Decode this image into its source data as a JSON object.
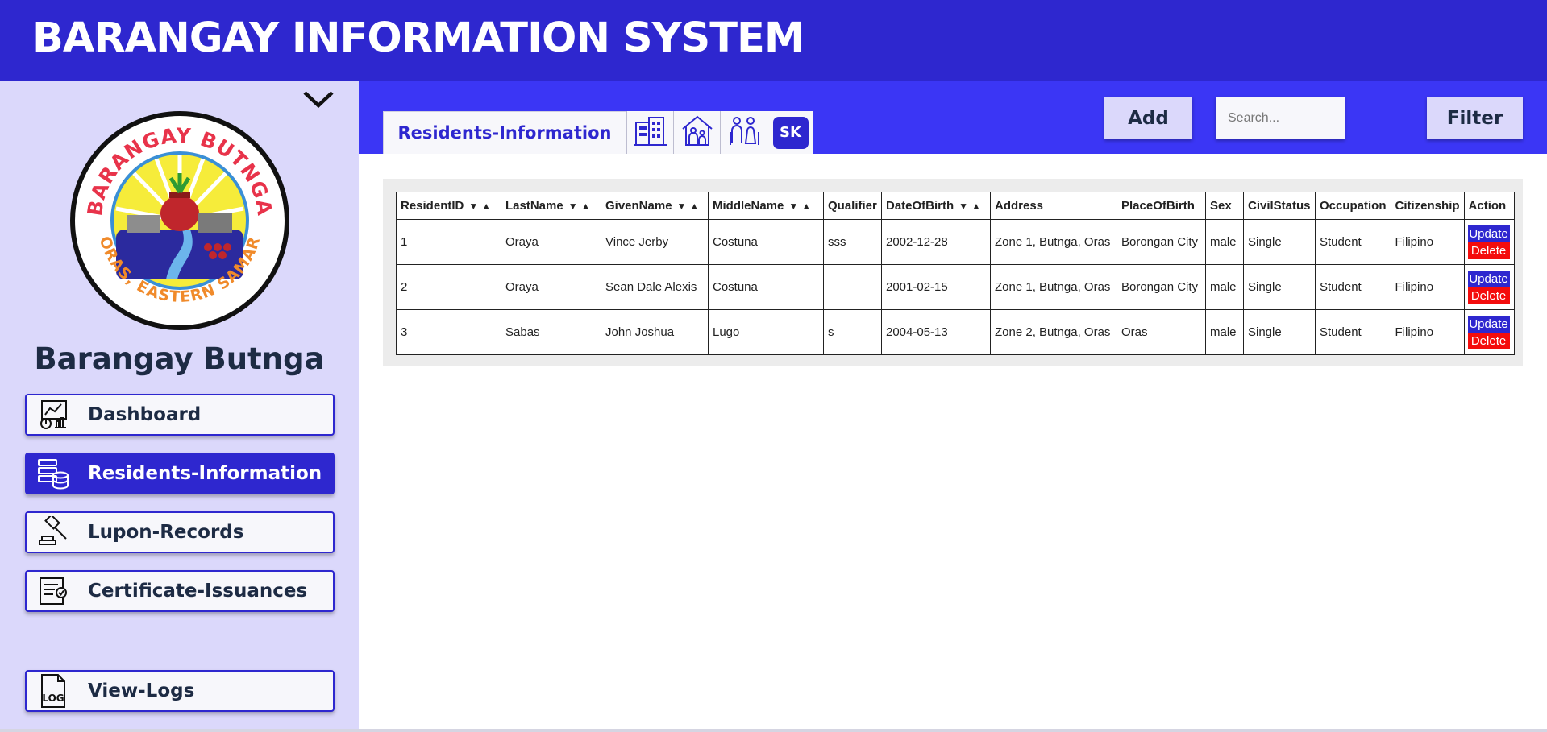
{
  "app": {
    "title": "BARANGAY INFORMATION SYSTEM"
  },
  "sidebar": {
    "barangay_name": "Barangay Butnga",
    "logo_text": {
      "top": "BARANGAY BUTNGA",
      "bottom": "ORAS, EASTERN SAMAR"
    },
    "items": [
      {
        "label": "Dashboard",
        "icon": "dashboard-chart-icon",
        "active": false
      },
      {
        "label": "Residents-Information",
        "icon": "database-icon",
        "active": true
      },
      {
        "label": "Lupon-Records",
        "icon": "gavel-icon",
        "active": false
      },
      {
        "label": "Certificate-Issuances",
        "icon": "certificate-icon",
        "active": false
      },
      {
        "label": "View-Logs",
        "icon": "log-file-icon",
        "active": false
      }
    ]
  },
  "main": {
    "tabs": {
      "active_label": "Residents-Information",
      "icon_tabs": [
        "buildings-icon",
        "house-family-icon",
        "elderly-couple-icon"
      ],
      "sk_label": "SK"
    },
    "toolbar": {
      "add_label": "Add",
      "search_placeholder": "Search...",
      "filter_label": "Filter"
    },
    "table": {
      "columns": [
        "ResidentID",
        "LastName",
        "GivenName",
        "MiddleName",
        "Qualifier",
        "DateOfBirth",
        "Address",
        "PlaceOfBirth",
        "Sex",
        "CivilStatus",
        "Occupation",
        "Citizenship",
        "Action"
      ],
      "sortable": [
        true,
        true,
        true,
        true,
        false,
        true,
        false,
        false,
        false,
        false,
        false,
        false,
        false
      ],
      "rows": [
        [
          "1",
          "Oraya",
          "Vince Jerby",
          "Costuna",
          "sss",
          "2002-12-28",
          "Zone 1, Butnga, Oras",
          "Borongan City",
          "male",
          "Single",
          "Student",
          "Filipino"
        ],
        [
          "2",
          "Oraya",
          "Sean Dale Alexis",
          "Costuna",
          "",
          "2001-02-15",
          "Zone 1, Butnga, Oras",
          "Borongan City",
          "male",
          "Single",
          "Student",
          "Filipino"
        ],
        [
          "3",
          "Sabas",
          "John Joshua",
          "Lugo",
          "s",
          "2004-05-13",
          "Zone 2, Butnga, Oras",
          "Oras",
          "male",
          "Single",
          "Student",
          "Filipino"
        ]
      ],
      "update_label": "Update",
      "delete_label": "Delete"
    }
  },
  "colors": {
    "primary": "#2e27cf",
    "topbar": "#3b36f5",
    "sidebar_bg": "#dbd8fb",
    "delete": "#f40c0c",
    "text_dark": "#1d2b44"
  }
}
